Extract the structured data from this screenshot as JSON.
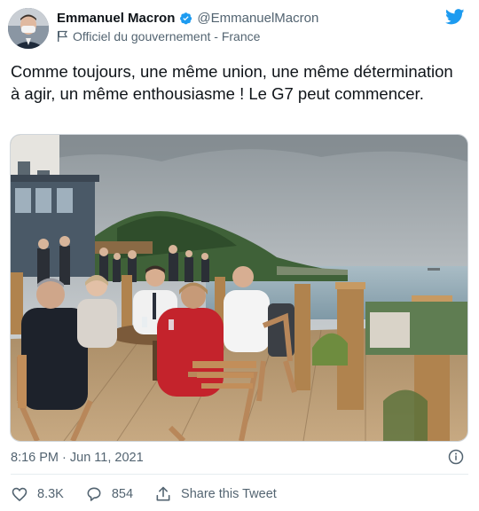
{
  "author": {
    "display_name": "Emmanuel Macron",
    "handle": "@EmmanuelMacron",
    "affiliation": "Officiel du gouvernement - France",
    "verified_icon": "verified-badge-icon",
    "avatar_icon": "avatar"
  },
  "tweet": {
    "text": "Comme toujours, une même union, une même détermination à agir, un même enthousiasme ! Le G7 peut commencer.",
    "timestamp": "8:16 PM · Jun 11, 2021"
  },
  "actions": {
    "likes": "8.3K",
    "replies": "854",
    "share_label": "Share this Tweet"
  },
  "colors": {
    "brand": "#1d9bf0",
    "text": "#0f1419",
    "secondary": "#536471"
  }
}
